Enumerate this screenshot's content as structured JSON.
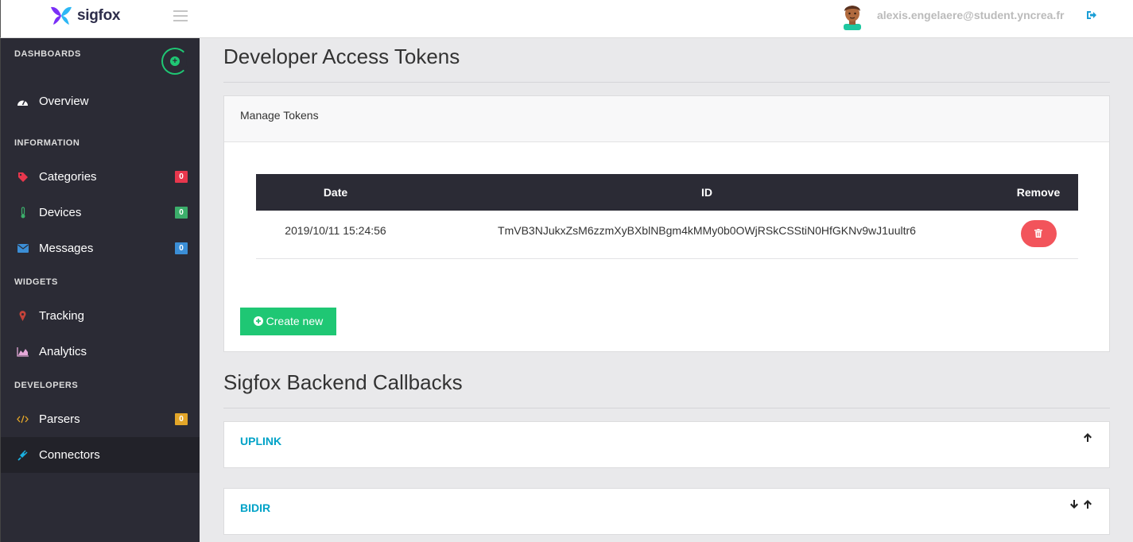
{
  "header": {
    "brand": "sigfox",
    "user_email": "alexis.engelaere@student.yncrea.fr"
  },
  "sidebar": {
    "sections": {
      "dashboards": "DASHBOARDS",
      "information": "INFORMATION",
      "widgets": "WIDGETS",
      "developers": "DEVELOPERS"
    },
    "items": [
      {
        "label": "Overview",
        "icon": "dashboard-icon"
      },
      {
        "label": "Categories",
        "icon": "tag-icon",
        "badge": "0",
        "badge_color": "#e8374d"
      },
      {
        "label": "Devices",
        "icon": "thermometer-icon",
        "badge": "0",
        "badge_color": "#3cae6b"
      },
      {
        "label": "Messages",
        "icon": "envelope-icon",
        "badge": "0",
        "badge_color": "#3b8ed6"
      },
      {
        "label": "Tracking",
        "icon": "map-marker-icon"
      },
      {
        "label": "Analytics",
        "icon": "area-chart-icon"
      },
      {
        "label": "Parsers",
        "icon": "code-icon",
        "badge": "0",
        "badge_color": "#e3a629"
      },
      {
        "label": "Connectors",
        "icon": "plug-icon"
      }
    ]
  },
  "main": {
    "title": "Developer Access Tokens",
    "tokens_panel": {
      "heading": "Manage Tokens",
      "columns": [
        "Date",
        "ID",
        "Remove"
      ],
      "rows": [
        {
          "date": "2019/10/11 15:24:56",
          "id": "TmVB3NJukxZsM6zzmXyBXblNBgm4kMMy0b0OWjRSkCSStiN0HfGKNv9wJ1uultr6"
        }
      ],
      "create_label": "Create new"
    },
    "callbacks_title": "Sigfox Backend Callbacks",
    "callbacks": [
      {
        "label": "UPLINK"
      },
      {
        "label": "BIDIR"
      }
    ]
  },
  "colors": {
    "sidebar_bg": "#2b2b35",
    "accent_green": "#1fc774",
    "danger": "#f2545b",
    "link": "#00a2c7"
  }
}
